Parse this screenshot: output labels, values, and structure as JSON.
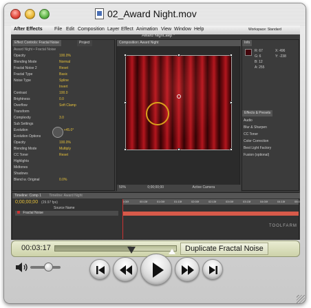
{
  "window": {
    "title": "02_Award Night.mov"
  },
  "app": {
    "menu": [
      "After Effects",
      "File",
      "Edit",
      "Composition",
      "Layer",
      "Effect",
      "Animation",
      "View",
      "Window",
      "Help"
    ],
    "document_title": "Award Night.aep *",
    "workspace_label": "Workspace: Standard"
  },
  "effects_panel": {
    "tabs": [
      "Effect Controls: Fractal Noise",
      "Project"
    ],
    "header": "Award Night • Fractal Noise",
    "rows": [
      {
        "label": "Opacity",
        "value": "100.0%"
      },
      {
        "label": "Blending Mode",
        "value": "Normal"
      },
      {
        "label": "Fractal Noise 2",
        "value": "Reset"
      },
      {
        "label": "Fractal Type",
        "value": "Basic"
      },
      {
        "label": "Noise Type",
        "value": "Spline"
      },
      {
        "label": "",
        "value": "Invert"
      },
      {
        "label": "Contrast",
        "value": "100.0"
      },
      {
        "label": "Brightness",
        "value": "0.0"
      },
      {
        "label": "Overflow",
        "value": "Soft Clamp"
      },
      {
        "label": "Transform",
        "value": ""
      },
      {
        "label": "Complexity",
        "value": "3.0"
      },
      {
        "label": "Sub Settings",
        "value": ""
      },
      {
        "label": "Evolution",
        "value": "1x +45.0°"
      },
      {
        "label": "Evolution Options",
        "value": ""
      },
      {
        "label": "Opacity",
        "value": "100.0%"
      },
      {
        "label": "Blending Mode",
        "value": "Multiply"
      },
      {
        "label": "CC Toner",
        "value": "Reset"
      },
      {
        "label": "Highlights",
        "value": ""
      },
      {
        "label": "Midtones",
        "value": ""
      },
      {
        "label": "Shadows",
        "value": ""
      },
      {
        "label": "Blend w. Original",
        "value": "0.0%"
      }
    ]
  },
  "comp_panel": {
    "tab": "Composition: Award Night",
    "zoom": "50%",
    "timecode": "0;00;00;00",
    "camera": "Active Camera"
  },
  "right_panel": {
    "info_tab": "Info",
    "info_values": [
      "R: 67",
      "G: 6",
      "B: 12",
      "A: 255",
      "X: 496",
      "Y: -238"
    ],
    "effects_tab": "Effects & Presets",
    "effects_items": [
      "Audio",
      "Blur & Sharpen",
      "CC Toner",
      "Color Correction",
      "Best Light Factory",
      "Fusion (optional)"
    ]
  },
  "timeline": {
    "tab": "Timeline: Comp 1",
    "tab2": "Timeline: Award Night",
    "timecode": "0;00;00;00",
    "fps": "(29.97 fps)",
    "columns": [
      "Source Name"
    ],
    "layer": "Fractal Noise",
    "ruler_marks": [
      "0:00f",
      "00:15f",
      "01:00f",
      "01:15f",
      "02:00f",
      "02:15f",
      "03:00f",
      "03:15f",
      "04:00f",
      "04:15f",
      "05:00f"
    ]
  },
  "watermark": "TOOLFARM",
  "player": {
    "current_time": "00:03:17",
    "chapter_label": "Duplicate Fractal Noise",
    "progress_fraction": 0.63,
    "volume_fraction": 0.6
  },
  "colors": {
    "accent_yellow": "#e6c13a",
    "timeline_bar": "#d75a4a",
    "close_red": "#e0463a",
    "minimize_yellow": "#e8b533",
    "zoom_green": "#5bb346"
  },
  "icons": {
    "play": "play-icon",
    "rewind": "rewind-icon",
    "fast_forward": "fast-forward-icon",
    "skip_back": "skip-to-start-icon",
    "skip_forward": "skip-to-end-icon",
    "volume": "speaker-icon"
  }
}
